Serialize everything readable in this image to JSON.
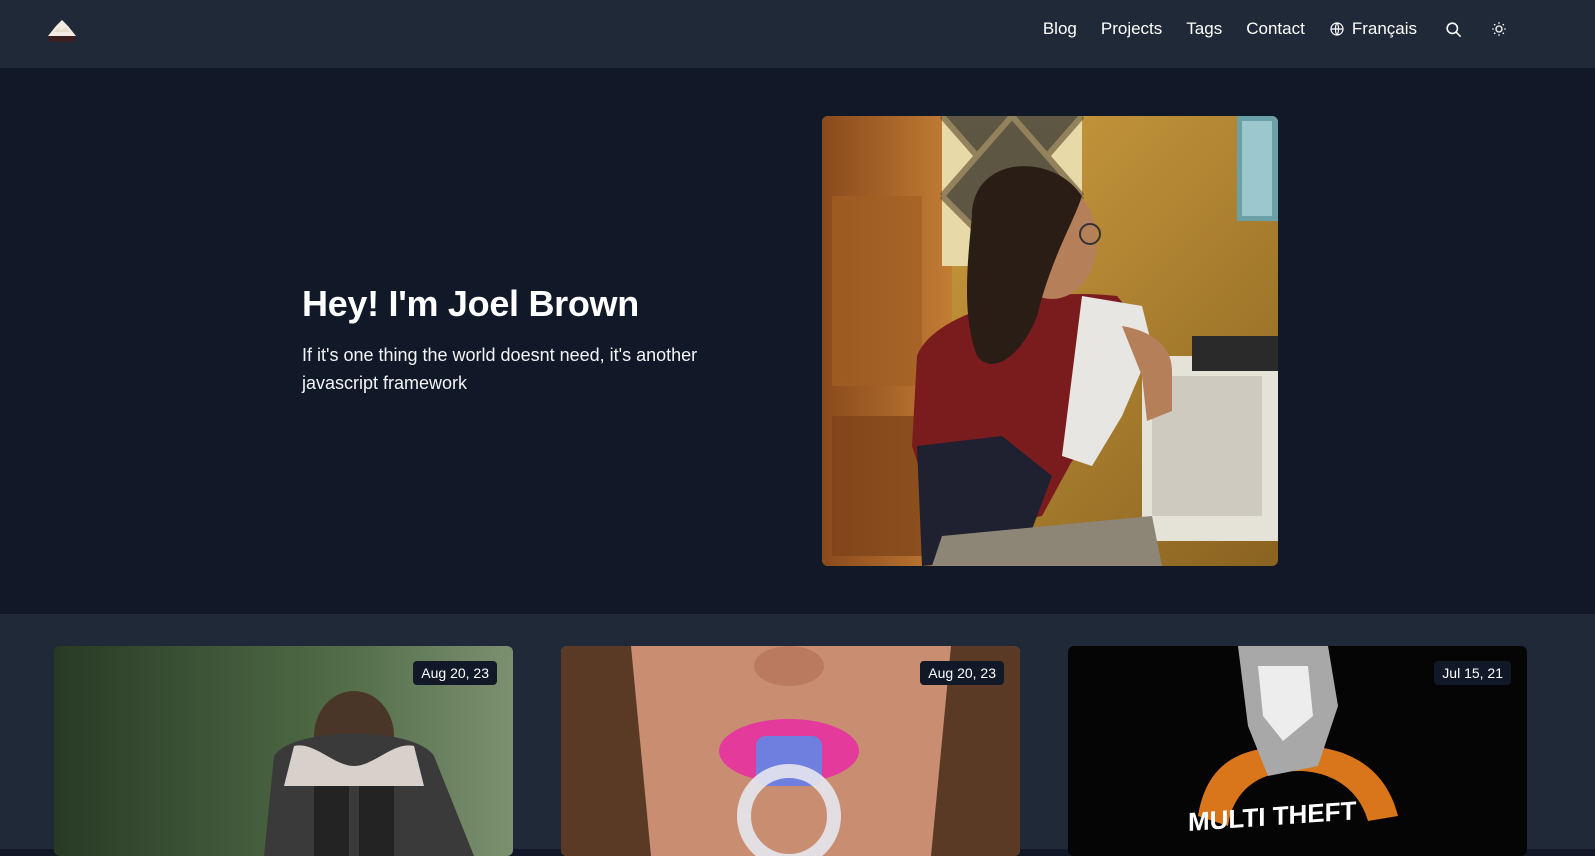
{
  "header": {
    "logo_icon": "mountain-logo-icon",
    "nav": [
      {
        "label": "Blog"
      },
      {
        "label": "Projects"
      },
      {
        "label": "Tags"
      },
      {
        "label": "Contact"
      }
    ],
    "language": {
      "icon": "globe-icon",
      "label": "Français"
    },
    "search_icon": "search-icon",
    "theme_icon": "sun-icon"
  },
  "hero": {
    "title": "Hey! I'm Joel Brown",
    "subtitle": "If it's one thing the world doesnt need, it's another javascript framework"
  },
  "posts": [
    {
      "date": "Aug 20, 23"
    },
    {
      "date": "Aug 20, 23"
    },
    {
      "date": "Jul 15, 21",
      "image_text": "MULTI THEFT"
    }
  ],
  "colors": {
    "header_bg": "#1f2937",
    "page_bg": "#111827",
    "badge_bg": "#111827",
    "text": "#ffffff"
  }
}
